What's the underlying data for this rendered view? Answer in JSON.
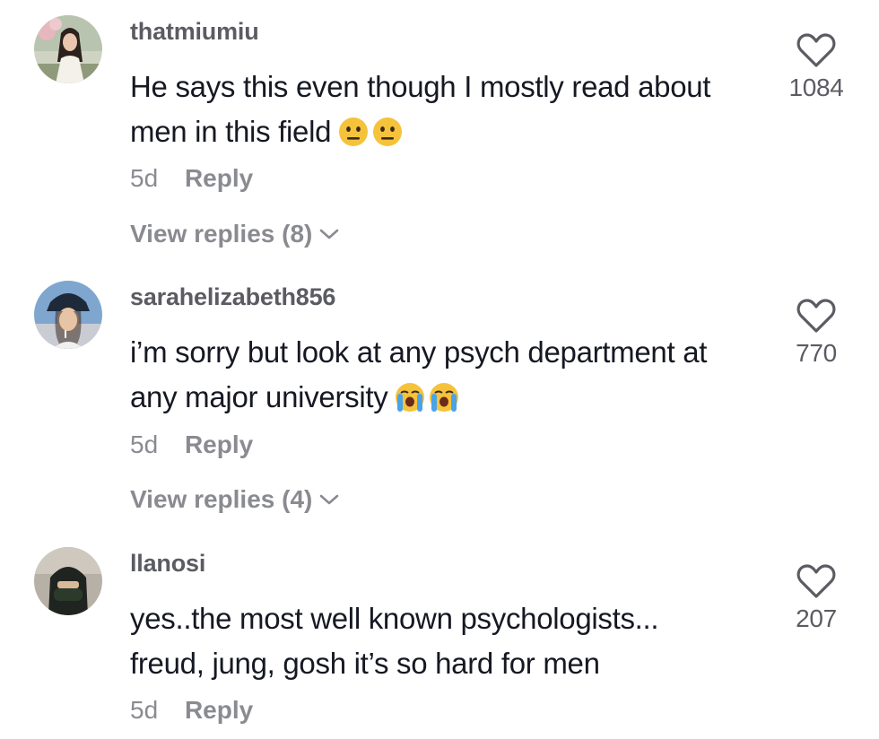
{
  "comments": [
    {
      "username": "thatmiumiu",
      "text_lines": [
        "He says this even though I mostly read about",
        "men in this field"
      ],
      "emoji": "neutral-face-emoji",
      "time": "5d",
      "reply_label": "Reply",
      "view_replies": "View replies (8)",
      "likes": "1084"
    },
    {
      "username": "sarahelizabeth856",
      "text_lines": [
        "i’m sorry but look at any psych department at",
        "any major university"
      ],
      "emoji": "loudly-crying-face-emoji",
      "time": "5d",
      "reply_label": "Reply",
      "view_replies": "View replies (4)",
      "likes": "770"
    },
    {
      "username": "llanosi",
      "text_lines": [
        "yes..the most well known psychologists...",
        "freud, jung, gosh it’s so hard for men"
      ],
      "time": "5d",
      "reply_label": "Reply",
      "likes": "207"
    }
  ],
  "colors": {
    "text": "#161823",
    "secondary": "#8a8b91",
    "username": "#5b5b63",
    "emoji_yellow": "#f5c33b",
    "tear_blue": "#4aa3e8"
  }
}
